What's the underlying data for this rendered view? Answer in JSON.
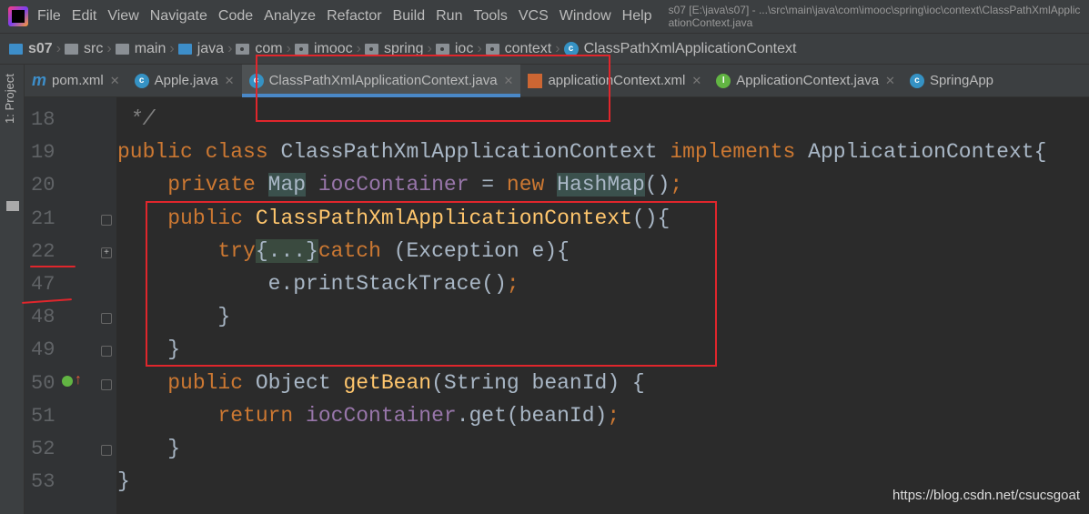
{
  "menu": [
    "File",
    "Edit",
    "View",
    "Navigate",
    "Code",
    "Analyze",
    "Refactor",
    "Build",
    "Run",
    "Tools",
    "VCS",
    "Window",
    "Help"
  ],
  "window_title": "s07 [E:\\java\\s07] - ...\\src\\main\\java\\com\\imooc\\spring\\ioc\\context\\ClassPathXmlApplicationContext.java",
  "breadcrumb": [
    {
      "label": "s07",
      "icon": "project"
    },
    {
      "label": "src",
      "icon": "folder"
    },
    {
      "label": "main",
      "icon": "folder"
    },
    {
      "label": "java",
      "icon": "source-folder"
    },
    {
      "label": "com",
      "icon": "package"
    },
    {
      "label": "imooc",
      "icon": "package"
    },
    {
      "label": "spring",
      "icon": "package"
    },
    {
      "label": "ioc",
      "icon": "package"
    },
    {
      "label": "context",
      "icon": "package"
    },
    {
      "label": "ClassPathXmlApplicationContext",
      "icon": "class"
    }
  ],
  "sidebar_label": "1: Project",
  "tabs": [
    {
      "label": "pom.xml",
      "icon": "maven",
      "active": false
    },
    {
      "label": "Apple.java",
      "icon": "class",
      "active": false
    },
    {
      "label": "ClassPathXmlApplicationContext.java",
      "icon": "class",
      "active": true
    },
    {
      "label": "applicationContext.xml",
      "icon": "xml",
      "active": false
    },
    {
      "label": "ApplicationContext.java",
      "icon": "interface",
      "active": false
    },
    {
      "label": "SpringApp",
      "icon": "class-run",
      "active": false
    }
  ],
  "line_numbers": [
    "18",
    "19",
    "20",
    "21",
    "22",
    "47",
    "48",
    "49",
    "50",
    "51",
    "52",
    "53"
  ],
  "code_lines": [
    [
      [
        "cm",
        " */"
      ]
    ],
    [
      [
        "kw",
        "public class "
      ],
      [
        "",
        "ClassPathXmlApplicationContext "
      ],
      [
        "kw",
        "implements "
      ],
      [
        "",
        "ApplicationContext{"
      ]
    ],
    [
      [
        "",
        "    "
      ],
      [
        "kw",
        "private "
      ],
      [
        "hl",
        "Map"
      ],
      [
        "",
        ""
      ],
      [
        "fld",
        " iocContainer"
      ],
      [
        "",
        " = "
      ],
      [
        "kw",
        "new "
      ],
      [
        "hl",
        "HashMap"
      ],
      [
        "",
        "()"
      ],
      [
        "kw",
        ";"
      ]
    ],
    [
      [
        "",
        "    "
      ],
      [
        "kw",
        "public "
      ],
      [
        "fn",
        "ClassPathXmlApplicationContext"
      ],
      [
        "",
        "(){"
      ]
    ],
    [
      [
        "",
        "        "
      ],
      [
        "kw",
        "try"
      ],
      [
        "fold-t",
        "{...}"
      ],
      [
        "kw",
        "catch "
      ],
      [
        "",
        "(Exception e){"
      ]
    ],
    [
      [
        "",
        "            e.printStackTrace()"
      ],
      [
        "kw",
        ";"
      ]
    ],
    [
      [
        "",
        "        }"
      ]
    ],
    [
      [
        "",
        "    }"
      ]
    ],
    [
      [
        "",
        "    "
      ],
      [
        "kw",
        "public "
      ],
      [
        "",
        "Object "
      ],
      [
        "fn",
        "getBean"
      ],
      [
        "",
        "(String beanId) {"
      ]
    ],
    [
      [
        "",
        "        "
      ],
      [
        "kw",
        "return "
      ],
      [
        "fld",
        "iocContainer"
      ],
      [
        "",
        ".get(beanId)"
      ],
      [
        "kw",
        ";"
      ]
    ],
    [
      [
        "",
        "    }"
      ]
    ],
    [
      [
        "",
        "}"
      ]
    ]
  ],
  "watermark": "https://blog.csdn.net/csucsgoat",
  "colors": {
    "keyword": "#cc7832",
    "method": "#ffc66d",
    "field": "#9876aa",
    "annotation": "#e0262c"
  }
}
